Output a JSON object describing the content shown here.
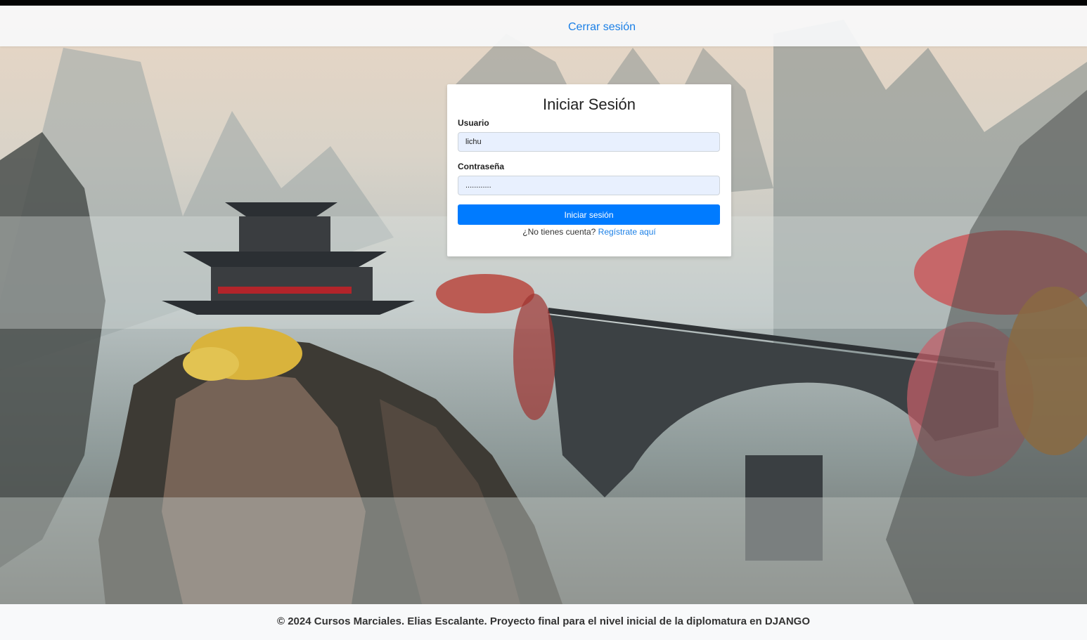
{
  "navbar": {
    "logout_label": "Cerrar sesión"
  },
  "login_card": {
    "title": "Iniciar Sesión",
    "username_label": "Usuario",
    "username_value": "lichu",
    "password_label": "Contraseña",
    "password_value": "............",
    "submit_label": "Iniciar sesión",
    "no_account_text": "¿No tienes cuenta?",
    "register_link": "Regístrate aquí"
  },
  "footer": {
    "text": "© 2024 Cursos Marciales. Elias Escalante. Proyecto final para el nivel inicial de la diplomatura en DJANGO"
  },
  "colors": {
    "accent": "#007bff",
    "link": "#1a7fe6",
    "navbar_bg": "#f8f9fa",
    "input_bg": "#e8f0fe"
  }
}
